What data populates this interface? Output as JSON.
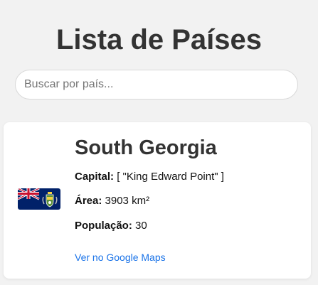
{
  "page": {
    "title": "Lista de Países"
  },
  "search": {
    "placeholder": "Buscar por país...",
    "value": ""
  },
  "country": {
    "name": "South Georgia",
    "flag_icon": "flag-south-georgia-icon",
    "capital_label": "Capital:",
    "capital_value": "[ \"King Edward Point\" ]",
    "area_label": "Área:",
    "area_value": "3903 km²",
    "population_label": "População:",
    "population_value": "30",
    "maps_link": "Ver no Google Maps"
  },
  "colors": {
    "background": "#f2f2f2",
    "card": "#ffffff",
    "link": "#1a73e8",
    "title": "#333333",
    "flag_blue": "#012169",
    "flag_red": "#C8102E"
  }
}
